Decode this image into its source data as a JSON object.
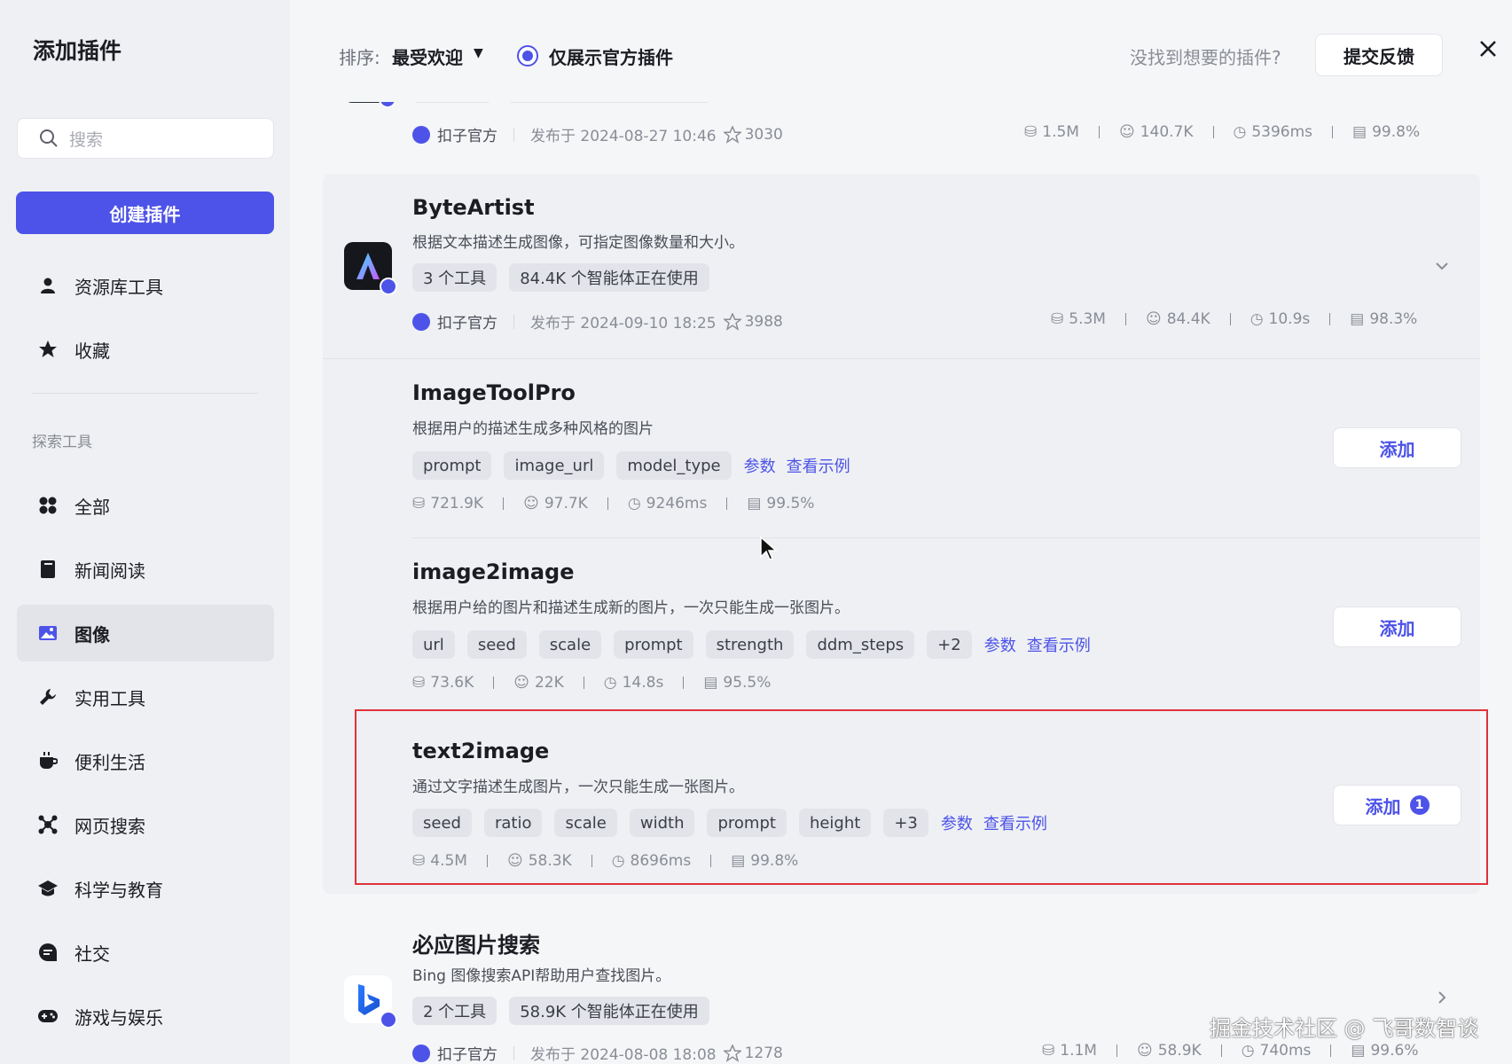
{
  "sidebar": {
    "title": "添加插件",
    "search_placeholder": "搜索",
    "create_button": "创建插件",
    "items_top": [
      {
        "label": "资源库工具",
        "icon": "user-icon"
      },
      {
        "label": "收藏",
        "icon": "star-icon"
      }
    ],
    "section_label": "探索工具",
    "items": [
      {
        "label": "全部",
        "icon": "grid-icon"
      },
      {
        "label": "新闻阅读",
        "icon": "book-icon"
      },
      {
        "label": "图像",
        "icon": "image-icon",
        "active": true
      },
      {
        "label": "实用工具",
        "icon": "wrench-icon"
      },
      {
        "label": "便利生活",
        "icon": "cup-icon"
      },
      {
        "label": "网页搜索",
        "icon": "network-icon"
      },
      {
        "label": "科学与教育",
        "icon": "graduation-cap-icon"
      },
      {
        "label": "社交",
        "icon": "chat-icon"
      },
      {
        "label": "游戏与娱乐",
        "icon": "gamepad-icon"
      }
    ]
  },
  "topbar": {
    "sort_label": "排序:",
    "sort_value": "最受欢迎",
    "official_only_label": "仅展示官方插件",
    "not_found_text": "没找到想要的插件?",
    "feedback_button": "提交反馈"
  },
  "plugins": {
    "top_partial": {
      "author": "扣子官方",
      "published": "发布于 2024-08-27 10:46",
      "stars": "3030",
      "calls": "1.5M",
      "bots": "140.7K",
      "latency": "5396ms",
      "success": "99.8%"
    },
    "byteartist": {
      "name": "ByteArtist",
      "desc": "根据文本描述生成图像，可指定图像数量和大小。",
      "tools_tag": "3 个工具",
      "usage_tag": "84.4K 个智能体正在使用",
      "author": "扣子官方",
      "published": "发布于 2024-09-10 18:25",
      "stars": "3988",
      "calls": "5.3M",
      "bots": "84.4K",
      "latency": "10.9s",
      "success": "98.3%"
    },
    "tools": [
      {
        "name": "ImageToolPro",
        "desc": "根据用户的描述生成多种风格的图片",
        "params": [
          "prompt",
          "image_url",
          "model_type"
        ],
        "params_link": "参数",
        "example_link": "查看示例",
        "calls": "721.9K",
        "bots": "97.7K",
        "latency": "9246ms",
        "success": "99.5%",
        "add_label": "添加"
      },
      {
        "name": "image2image",
        "desc": "根据用户给的图片和描述生成新的图片，一次只能生成一张图片。",
        "params": [
          "url",
          "seed",
          "scale",
          "prompt",
          "strength",
          "ddm_steps",
          "+2"
        ],
        "params_link": "参数",
        "example_link": "查看示例",
        "calls": "73.6K",
        "bots": "22K",
        "latency": "14.8s",
        "success": "95.5%",
        "add_label": "添加"
      },
      {
        "name": "text2image",
        "desc": "通过文字描述生成图片，一次只能生成一张图片。",
        "params": [
          "seed",
          "ratio",
          "scale",
          "width",
          "prompt",
          "height",
          "+3"
        ],
        "params_link": "参数",
        "example_link": "查看示例",
        "calls": "4.5M",
        "bots": "58.3K",
        "latency": "8696ms",
        "success": "99.8%",
        "add_label": "添加",
        "added_count": "1"
      }
    ],
    "bing": {
      "name": "必应图片搜索",
      "desc": "Bing 图像搜索API帮助用户查找图片。",
      "tools_tag": "2 个工具",
      "usage_tag": "58.9K 个智能体正在使用",
      "author": "扣子官方",
      "published": "发布于 2024-08-08 18:08",
      "stars": "1278",
      "calls": "1.1M",
      "bots": "58.9K",
      "latency": "740ms",
      "success": "99.6%"
    }
  },
  "watermark": "掘金技术社区 @ 飞哥数智谈",
  "colors": {
    "accent": "#4d53e8",
    "highlight": "#e0323c"
  }
}
